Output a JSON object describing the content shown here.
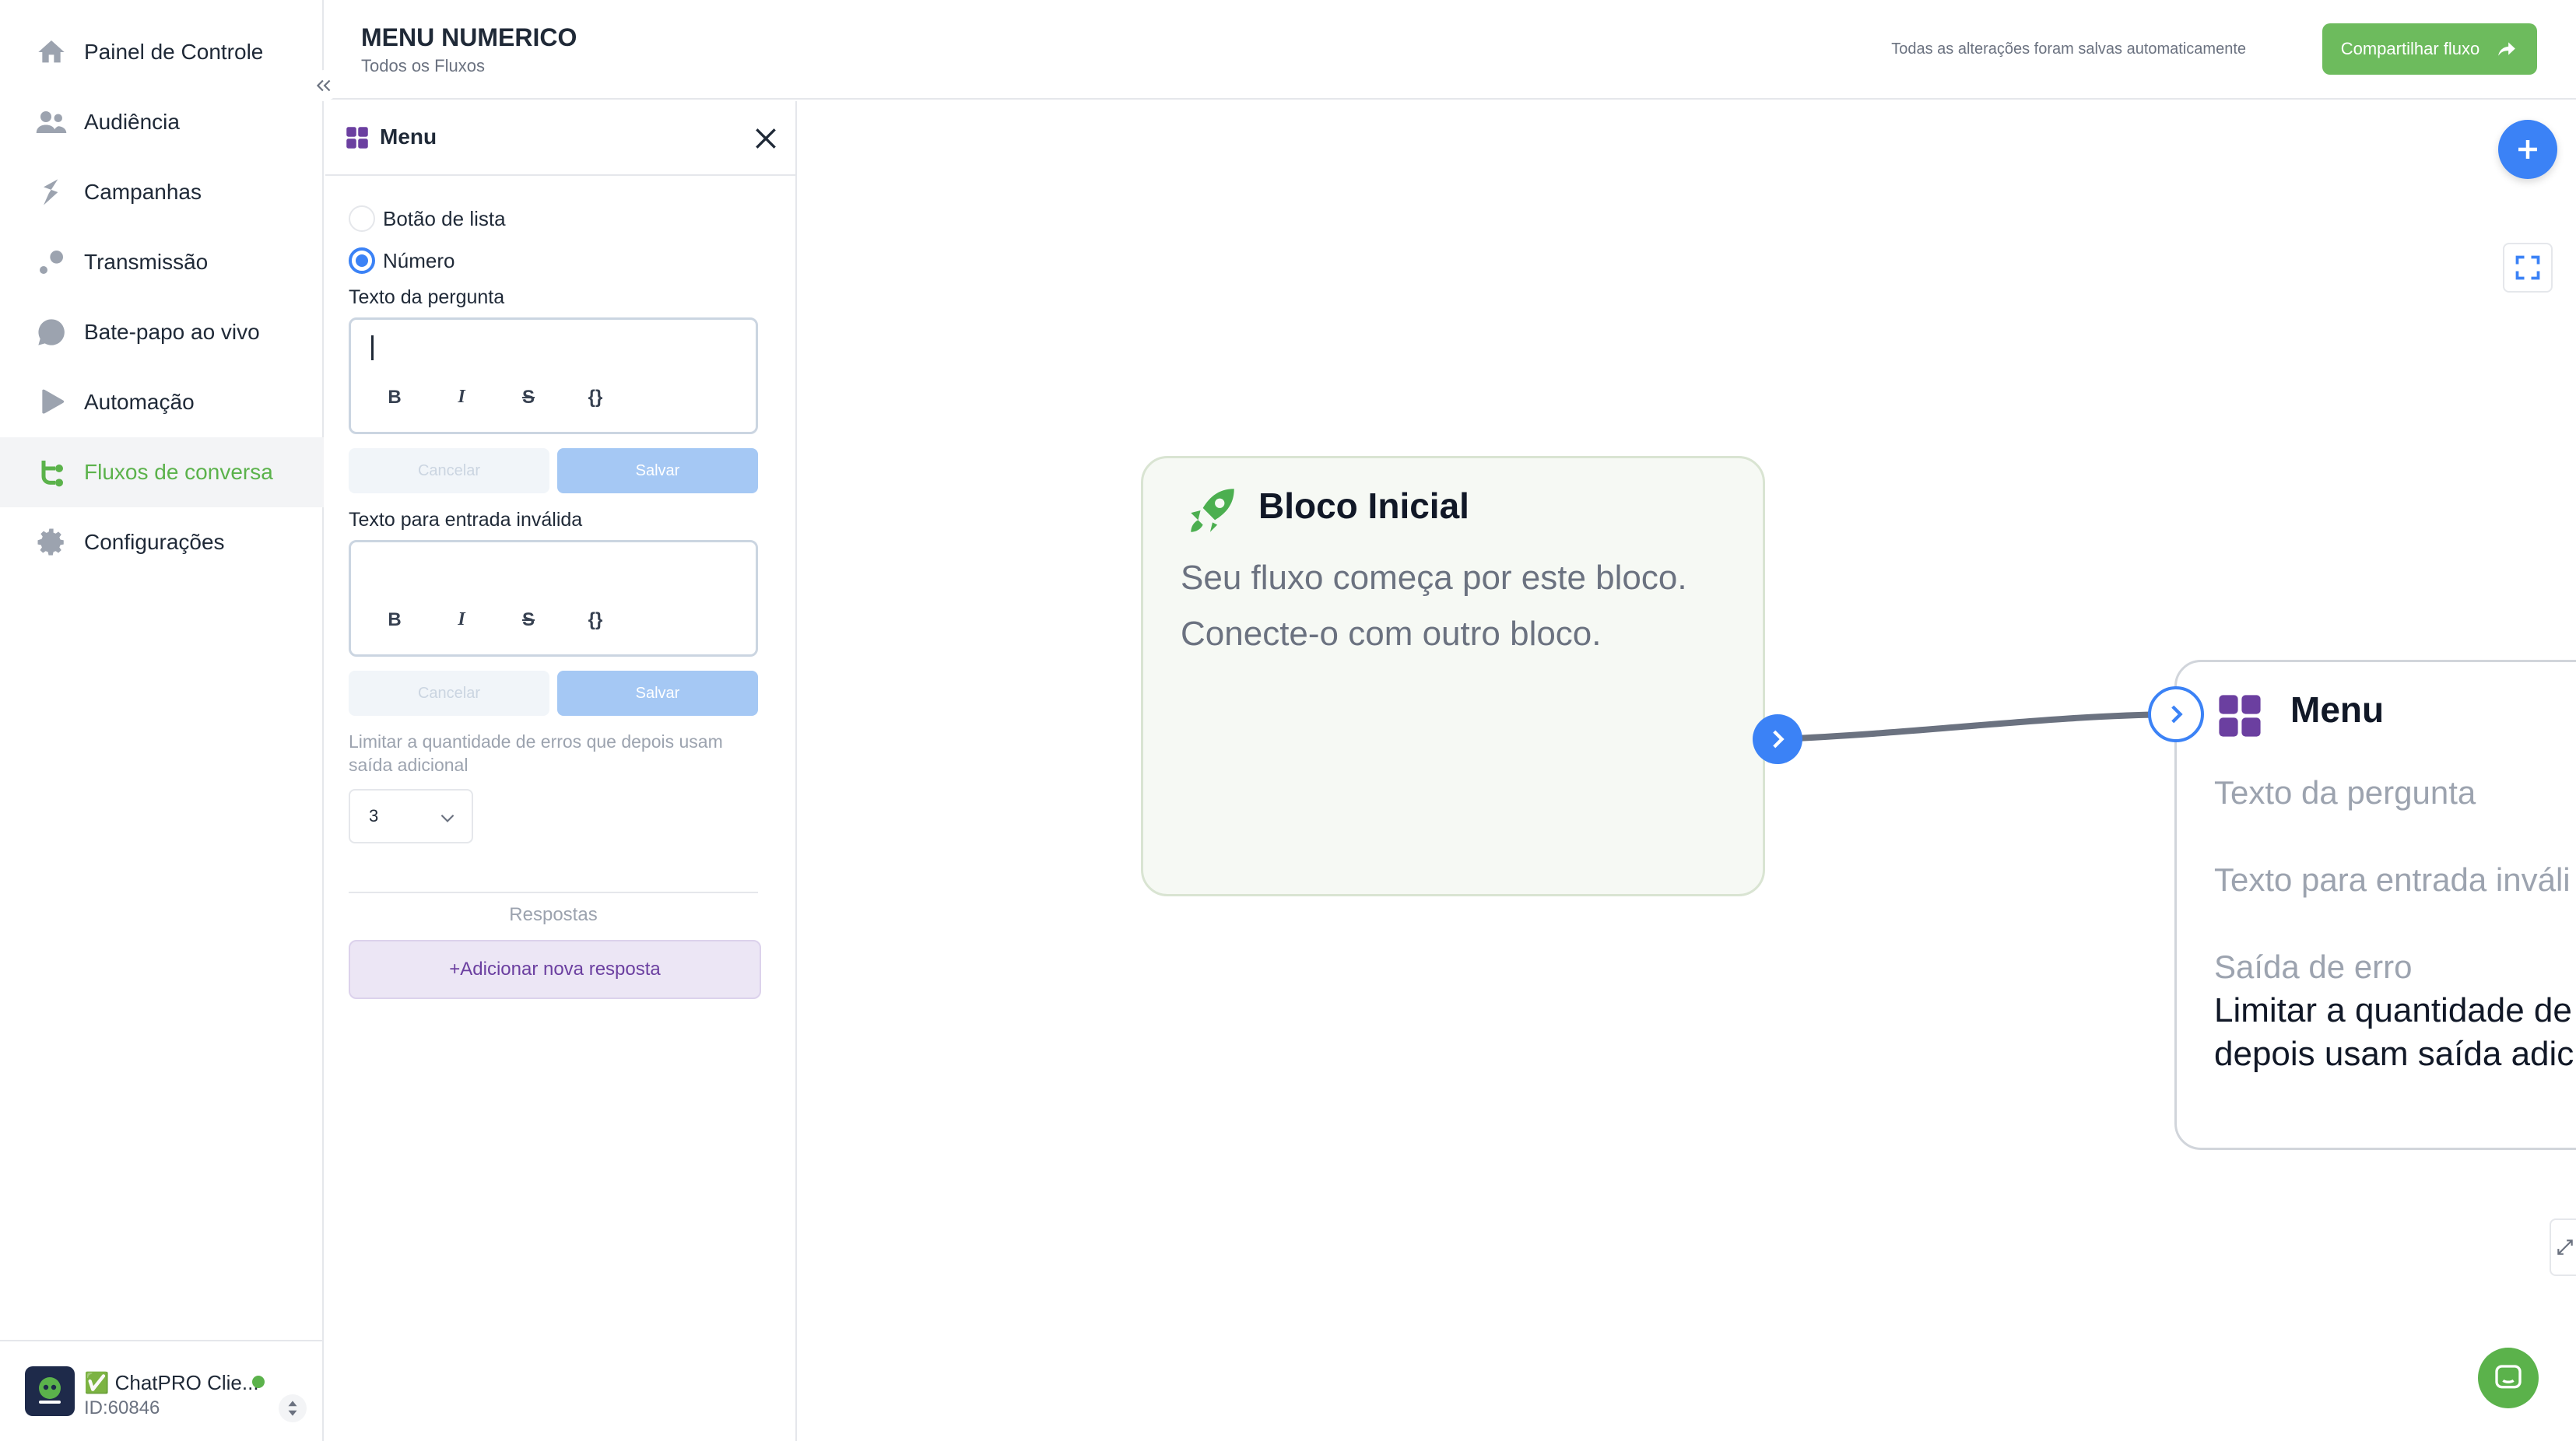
{
  "sidebar": {
    "items": [
      {
        "label": "Painel de Controle",
        "icon": "home-icon"
      },
      {
        "label": "Audiência",
        "icon": "users-icon"
      },
      {
        "label": "Campanhas",
        "icon": "campaign-icon"
      },
      {
        "label": "Transmissão",
        "icon": "broadcast-icon"
      },
      {
        "label": "Bate-papo ao vivo",
        "icon": "chat-icon"
      },
      {
        "label": "Automação",
        "icon": "automation-icon"
      },
      {
        "label": "Fluxos de conversa",
        "icon": "flow-icon"
      },
      {
        "label": "Configurações",
        "icon": "gear-icon"
      }
    ],
    "active_item": "Fluxos de conversa",
    "account": {
      "name": "✅ ChatPRO Clie...",
      "id": "ID:60846",
      "avatar_text": "ChatPRO"
    }
  },
  "header": {
    "title": "MENU NUMERICO",
    "breadcrumb": "Todos os Fluxos",
    "autosave": "Todas as alterações foram salvas automaticamente",
    "share_label": "Compartilhar fluxo"
  },
  "panel": {
    "title": "Menu",
    "options": [
      {
        "label": "Botão de lista",
        "selected": false
      },
      {
        "label": "Número",
        "selected": true
      }
    ],
    "question_label": "Texto da pergunta",
    "invalid_label": "Texto para entrada inválida",
    "format_buttons": [
      "B",
      "I",
      "S",
      "{}"
    ],
    "cancel_label": "Cancelar",
    "save_label": "Salvar",
    "error_limit_help": "Limitar a quantidade de erros que depois usam saída adicional",
    "error_limit_value": "3",
    "responses_title": "Respostas",
    "add_response_label": "+Adicionar nova resposta"
  },
  "canvas": {
    "start_block": {
      "title": "Bloco Inicial",
      "line1": "Seu fluxo começa por este bloco.",
      "line2": "Conecte-o com outro bloco."
    },
    "menu_block": {
      "title": "Menu",
      "question": "Texto da pergunta",
      "invalid": "Texto para entrada inváli",
      "error_out": "Saída de erro",
      "limit_line1": "Limitar a quantidade de",
      "limit_line2": "depois usam saída adic"
    }
  },
  "colors": {
    "accent_green": "#5bb24b",
    "accent_blue": "#3b82f6",
    "menu_purple": "#6b3fa0"
  }
}
